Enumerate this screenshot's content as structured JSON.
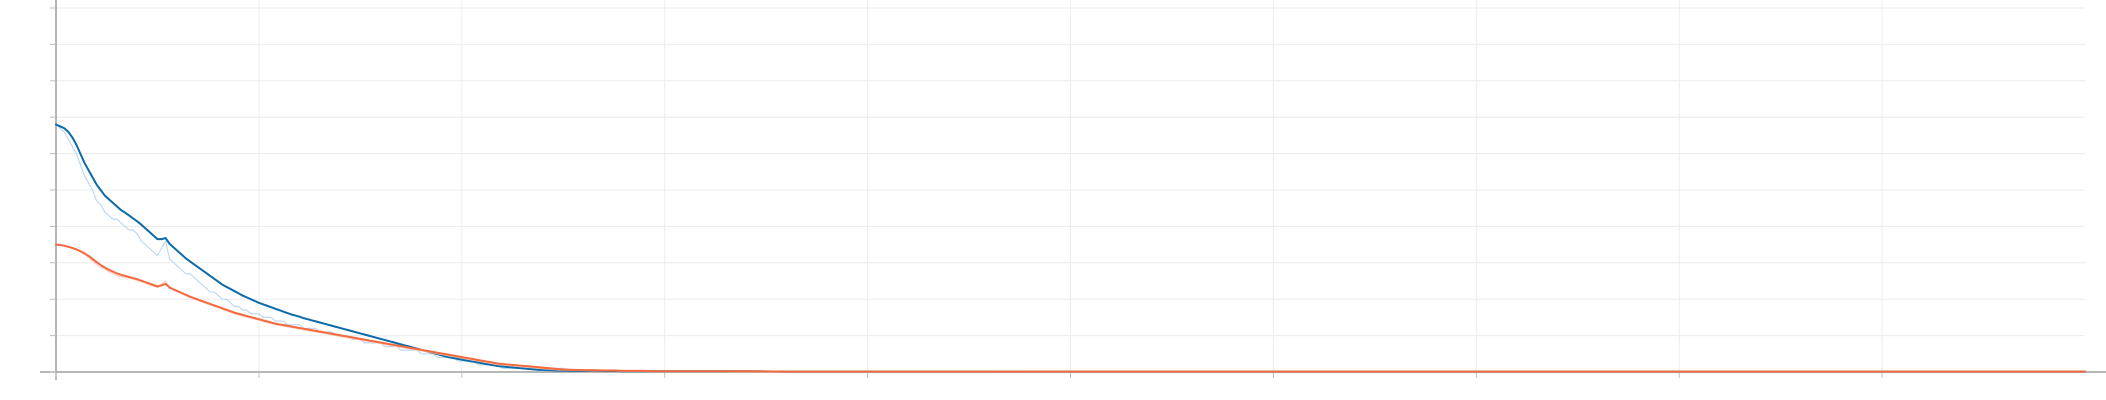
{
  "chart_data": {
    "type": "line",
    "title": "",
    "xlabel": "",
    "ylabel": "",
    "xlim": [
      0,
      1000
    ],
    "ylim": [
      0,
      1.0
    ],
    "x_ticks": [
      0,
      100,
      200,
      300,
      400,
      500,
      600,
      700,
      800,
      900
    ],
    "y_ticks": [
      0,
      0.1,
      0.2,
      0.3,
      0.4,
      0.5,
      0.6,
      0.7,
      0.8,
      0.9,
      1.0
    ],
    "grid": true,
    "tick_labels_visible": false,
    "series": [
      {
        "key": "blue_raw",
        "color": "#b7d6ec",
        "opacity": 0.9,
        "x": [
          0,
          2,
          4,
          6,
          8,
          10,
          12,
          14,
          16,
          18,
          20,
          22,
          24,
          26,
          28,
          30,
          32,
          34,
          36,
          38,
          40,
          42,
          44,
          46,
          48,
          50,
          52,
          54,
          56,
          58,
          60,
          62,
          64,
          66,
          68,
          70,
          72,
          74,
          76,
          78,
          80,
          82,
          84,
          86,
          88,
          90,
          92,
          94,
          96,
          98,
          100,
          102,
          104,
          106,
          108,
          110,
          112,
          114,
          116,
          118,
          120,
          122,
          124,
          126,
          128,
          130,
          132,
          134,
          136,
          138,
          140,
          142,
          144,
          146,
          148,
          150,
          152,
          154,
          156,
          158,
          160,
          162,
          164,
          166,
          168,
          170,
          172,
          174,
          176,
          178,
          180,
          182,
          184,
          186,
          188,
          190,
          192,
          194,
          196,
          198,
          200,
          202,
          204,
          206,
          208,
          210,
          212,
          214,
          216,
          218,
          220,
          222,
          224,
          226,
          228,
          230,
          232,
          234,
          236,
          238,
          240,
          242,
          244,
          246,
          248,
          250,
          255,
          260,
          265,
          270,
          275,
          280,
          285,
          290,
          295,
          300,
          310,
          320,
          340,
          360,
          380,
          400,
          450,
          500,
          600,
          700,
          800,
          900,
          1000
        ],
        "y": [
          0.68,
          0.67,
          0.66,
          0.64,
          0.62,
          0.6,
          0.57,
          0.54,
          0.52,
          0.5,
          0.47,
          0.46,
          0.44,
          0.43,
          0.42,
          0.42,
          0.41,
          0.4,
          0.39,
          0.39,
          0.38,
          0.36,
          0.35,
          0.34,
          0.33,
          0.32,
          0.34,
          0.36,
          0.31,
          0.3,
          0.29,
          0.28,
          0.27,
          0.27,
          0.26,
          0.25,
          0.24,
          0.23,
          0.22,
          0.22,
          0.21,
          0.2,
          0.2,
          0.19,
          0.18,
          0.18,
          0.17,
          0.17,
          0.16,
          0.16,
          0.16,
          0.15,
          0.15,
          0.15,
          0.14,
          0.14,
          0.14,
          0.13,
          0.13,
          0.13,
          0.13,
          0.12,
          0.12,
          0.12,
          0.12,
          0.11,
          0.11,
          0.11,
          0.11,
          0.1,
          0.1,
          0.1,
          0.1,
          0.09,
          0.09,
          0.09,
          0.08,
          0.08,
          0.08,
          0.08,
          0.08,
          0.07,
          0.07,
          0.07,
          0.07,
          0.06,
          0.06,
          0.06,
          0.06,
          0.06,
          0.05,
          0.05,
          0.05,
          0.05,
          0.04,
          0.04,
          0.04,
          0.04,
          0.04,
          0.03,
          0.03,
          0.03,
          0.03,
          0.03,
          0.02,
          0.02,
          0.02,
          0.02,
          0.02,
          0.02,
          0.01,
          0.01,
          0.01,
          0.01,
          0.01,
          0.01,
          0.01,
          0.01,
          0.01,
          0.01,
          0.01,
          0.01,
          0.01,
          0.01,
          0.01,
          0.01,
          0.005,
          0.005,
          0.005,
          0.005,
          0.005,
          0.004,
          0.004,
          0.004,
          0.004,
          0.003,
          0.003,
          0.003,
          0.003,
          0.002,
          0.002,
          0.002,
          0.002,
          0.001,
          0.001,
          0.001,
          0.001,
          0.001,
          0.001
        ]
      },
      {
        "key": "blue",
        "color": "#0b6aa8",
        "opacity": 1,
        "x": [
          0,
          2,
          4,
          6,
          8,
          10,
          12,
          14,
          16,
          18,
          20,
          22,
          24,
          26,
          28,
          30,
          32,
          34,
          36,
          38,
          40,
          42,
          44,
          46,
          48,
          50,
          52,
          54,
          56,
          58,
          60,
          62,
          64,
          66,
          68,
          70,
          72,
          74,
          76,
          78,
          80,
          82,
          84,
          86,
          88,
          90,
          92,
          94,
          96,
          98,
          100,
          102,
          104,
          106,
          108,
          110,
          112,
          114,
          116,
          118,
          120,
          122,
          124,
          126,
          128,
          130,
          132,
          134,
          136,
          138,
          140,
          142,
          144,
          146,
          148,
          150,
          152,
          154,
          156,
          158,
          160,
          162,
          164,
          166,
          168,
          170,
          172,
          174,
          176,
          178,
          180,
          182,
          184,
          186,
          188,
          190,
          192,
          194,
          196,
          198,
          200,
          202,
          204,
          206,
          208,
          210,
          212,
          214,
          216,
          218,
          220,
          222,
          224,
          226,
          228,
          230,
          232,
          234,
          236,
          238,
          240,
          242,
          244,
          246,
          248,
          250,
          255,
          260,
          265,
          270,
          275,
          280,
          285,
          290,
          295,
          300,
          310,
          320,
          340,
          360,
          380,
          400,
          450,
          500,
          600,
          700,
          800,
          900,
          1000
        ],
        "y": [
          0.68,
          0.675,
          0.67,
          0.66,
          0.645,
          0.625,
          0.6,
          0.575,
          0.555,
          0.535,
          0.515,
          0.5,
          0.485,
          0.475,
          0.465,
          0.455,
          0.445,
          0.438,
          0.43,
          0.422,
          0.414,
          0.405,
          0.395,
          0.385,
          0.375,
          0.365,
          0.365,
          0.368,
          0.352,
          0.342,
          0.332,
          0.322,
          0.312,
          0.304,
          0.296,
          0.288,
          0.28,
          0.272,
          0.264,
          0.256,
          0.248,
          0.24,
          0.234,
          0.228,
          0.222,
          0.216,
          0.21,
          0.205,
          0.2,
          0.195,
          0.19,
          0.186,
          0.182,
          0.178,
          0.174,
          0.17,
          0.166,
          0.162,
          0.158,
          0.155,
          0.152,
          0.148,
          0.145,
          0.142,
          0.139,
          0.136,
          0.133,
          0.13,
          0.127,
          0.124,
          0.121,
          0.118,
          0.115,
          0.112,
          0.109,
          0.106,
          0.103,
          0.1,
          0.097,
          0.094,
          0.091,
          0.088,
          0.085,
          0.082,
          0.079,
          0.076,
          0.073,
          0.07,
          0.067,
          0.064,
          0.061,
          0.058,
          0.055,
          0.052,
          0.049,
          0.046,
          0.043,
          0.04,
          0.038,
          0.036,
          0.034,
          0.032,
          0.03,
          0.028,
          0.026,
          0.024,
          0.022,
          0.02,
          0.018,
          0.016,
          0.015,
          0.014,
          0.013,
          0.012,
          0.011,
          0.01,
          0.009,
          0.008,
          0.007,
          0.006,
          0.006,
          0.005,
          0.005,
          0.004,
          0.004,
          0.004,
          0.003,
          0.003,
          0.003,
          0.003,
          0.003,
          0.002,
          0.002,
          0.002,
          0.002,
          0.002,
          0.002,
          0.002,
          0.002,
          0.001,
          0.001,
          0.001,
          0.001,
          0.001,
          0.001,
          0.001,
          0.001,
          0.001,
          0.001
        ]
      },
      {
        "key": "orange_raw",
        "color": "#f7c5b3",
        "opacity": 0.8,
        "x": [
          0,
          2,
          4,
          6,
          8,
          10,
          12,
          14,
          16,
          18,
          20,
          22,
          24,
          26,
          28,
          30,
          32,
          34,
          36,
          38,
          40,
          42,
          44,
          46,
          48,
          50,
          52,
          54,
          56,
          58,
          60,
          62,
          64,
          66,
          68,
          70,
          72,
          74,
          76,
          78,
          80,
          82,
          84,
          86,
          88,
          90,
          92,
          94,
          96,
          98,
          100,
          102,
          104,
          106,
          108,
          110,
          112,
          114,
          116,
          118,
          120,
          122,
          124,
          126,
          128,
          130,
          132,
          134,
          136,
          138,
          140,
          142,
          144,
          146,
          148,
          150,
          152,
          154,
          156,
          158,
          160,
          162,
          164,
          166,
          168,
          170,
          172,
          174,
          176,
          178,
          180,
          182,
          184,
          186,
          188,
          190,
          192,
          194,
          196,
          198,
          200,
          202,
          204,
          206,
          208,
          210,
          212,
          214,
          216,
          218,
          220,
          222,
          224,
          226,
          228,
          230,
          232,
          234,
          236,
          238,
          240,
          242,
          244,
          246,
          248,
          250,
          255,
          260,
          265,
          270,
          275,
          280,
          285,
          290,
          295,
          300,
          310,
          320,
          340,
          360,
          380,
          400,
          450,
          500,
          600,
          700,
          800,
          900,
          1000
        ],
        "y": [
          0.35,
          0.348,
          0.346,
          0.343,
          0.34,
          0.335,
          0.33,
          0.323,
          0.315,
          0.305,
          0.295,
          0.288,
          0.282,
          0.276,
          0.27,
          0.265,
          0.262,
          0.26,
          0.258,
          0.255,
          0.252,
          0.248,
          0.244,
          0.24,
          0.236,
          0.232,
          0.24,
          0.25,
          0.23,
          0.225,
          0.22,
          0.215,
          0.21,
          0.205,
          0.2,
          0.196,
          0.192,
          0.188,
          0.184,
          0.18,
          0.176,
          0.172,
          0.168,
          0.164,
          0.16,
          0.157,
          0.154,
          0.151,
          0.148,
          0.145,
          0.142,
          0.139,
          0.136,
          0.133,
          0.13,
          0.128,
          0.126,
          0.124,
          0.122,
          0.12,
          0.118,
          0.116,
          0.114,
          0.112,
          0.11,
          0.108,
          0.106,
          0.104,
          0.102,
          0.1,
          0.098,
          0.096,
          0.094,
          0.092,
          0.09,
          0.088,
          0.086,
          0.084,
          0.082,
          0.08,
          0.078,
          0.076,
          0.074,
          0.072,
          0.07,
          0.068,
          0.066,
          0.064,
          0.062,
          0.06,
          0.058,
          0.056,
          0.054,
          0.052,
          0.05,
          0.048,
          0.046,
          0.044,
          0.042,
          0.04,
          0.038,
          0.036,
          0.034,
          0.032,
          0.03,
          0.028,
          0.026,
          0.024,
          0.022,
          0.02,
          0.019,
          0.018,
          0.017,
          0.016,
          0.015,
          0.014,
          0.013,
          0.012,
          0.011,
          0.01,
          0.009,
          0.008,
          0.007,
          0.006,
          0.005,
          0.005,
          0.004,
          0.004,
          0.003,
          0.003,
          0.003,
          0.002,
          0.002,
          0.002,
          0.002,
          0.002,
          0.002,
          0.002,
          0.001,
          0.001,
          0.001,
          0.001,
          0.001,
          0.001,
          0.001,
          0.001,
          0.001,
          0.001,
          0.001
        ]
      },
      {
        "key": "orange",
        "color": "#f46a3e",
        "opacity": 1,
        "x": [
          0,
          2,
          4,
          6,
          8,
          10,
          12,
          14,
          16,
          18,
          20,
          22,
          24,
          26,
          28,
          30,
          32,
          34,
          36,
          38,
          40,
          42,
          44,
          46,
          48,
          50,
          52,
          54,
          56,
          58,
          60,
          62,
          64,
          66,
          68,
          70,
          72,
          74,
          76,
          78,
          80,
          82,
          84,
          86,
          88,
          90,
          92,
          94,
          96,
          98,
          100,
          102,
          104,
          106,
          108,
          110,
          112,
          114,
          116,
          118,
          120,
          122,
          124,
          126,
          128,
          130,
          132,
          134,
          136,
          138,
          140,
          142,
          144,
          146,
          148,
          150,
          152,
          154,
          156,
          158,
          160,
          162,
          164,
          166,
          168,
          170,
          172,
          174,
          176,
          178,
          180,
          182,
          184,
          186,
          188,
          190,
          192,
          194,
          196,
          198,
          200,
          202,
          204,
          206,
          208,
          210,
          212,
          214,
          216,
          218,
          220,
          222,
          224,
          226,
          228,
          230,
          232,
          234,
          236,
          238,
          240,
          242,
          244,
          246,
          248,
          250,
          255,
          260,
          265,
          270,
          275,
          280,
          285,
          290,
          295,
          300,
          310,
          320,
          340,
          360,
          380,
          400,
          450,
          500,
          600,
          700,
          800,
          900,
          1000
        ],
        "y": [
          0.35,
          0.349,
          0.347,
          0.344,
          0.341,
          0.337,
          0.332,
          0.326,
          0.319,
          0.311,
          0.302,
          0.294,
          0.287,
          0.281,
          0.276,
          0.271,
          0.267,
          0.264,
          0.261,
          0.258,
          0.255,
          0.251,
          0.247,
          0.243,
          0.239,
          0.235,
          0.238,
          0.242,
          0.232,
          0.227,
          0.222,
          0.217,
          0.212,
          0.207,
          0.203,
          0.199,
          0.195,
          0.191,
          0.187,
          0.183,
          0.179,
          0.175,
          0.171,
          0.167,
          0.163,
          0.16,
          0.157,
          0.154,
          0.151,
          0.148,
          0.145,
          0.142,
          0.139,
          0.136,
          0.133,
          0.131,
          0.129,
          0.127,
          0.125,
          0.123,
          0.121,
          0.119,
          0.117,
          0.115,
          0.113,
          0.111,
          0.109,
          0.107,
          0.105,
          0.103,
          0.101,
          0.099,
          0.097,
          0.095,
          0.093,
          0.091,
          0.089,
          0.087,
          0.085,
          0.083,
          0.081,
          0.079,
          0.077,
          0.075,
          0.073,
          0.071,
          0.069,
          0.067,
          0.065,
          0.063,
          0.061,
          0.059,
          0.057,
          0.055,
          0.053,
          0.051,
          0.049,
          0.047,
          0.045,
          0.043,
          0.041,
          0.039,
          0.037,
          0.035,
          0.033,
          0.031,
          0.029,
          0.027,
          0.025,
          0.023,
          0.022,
          0.021,
          0.02,
          0.019,
          0.018,
          0.017,
          0.016,
          0.015,
          0.014,
          0.013,
          0.012,
          0.011,
          0.01,
          0.009,
          0.008,
          0.007,
          0.006,
          0.005,
          0.005,
          0.004,
          0.004,
          0.003,
          0.003,
          0.003,
          0.002,
          0.002,
          0.002,
          0.002,
          0.002,
          0.001,
          0.001,
          0.001,
          0.001,
          0.001,
          0.001,
          0.001,
          0.001,
          0.001,
          0.001
        ]
      }
    ]
  }
}
